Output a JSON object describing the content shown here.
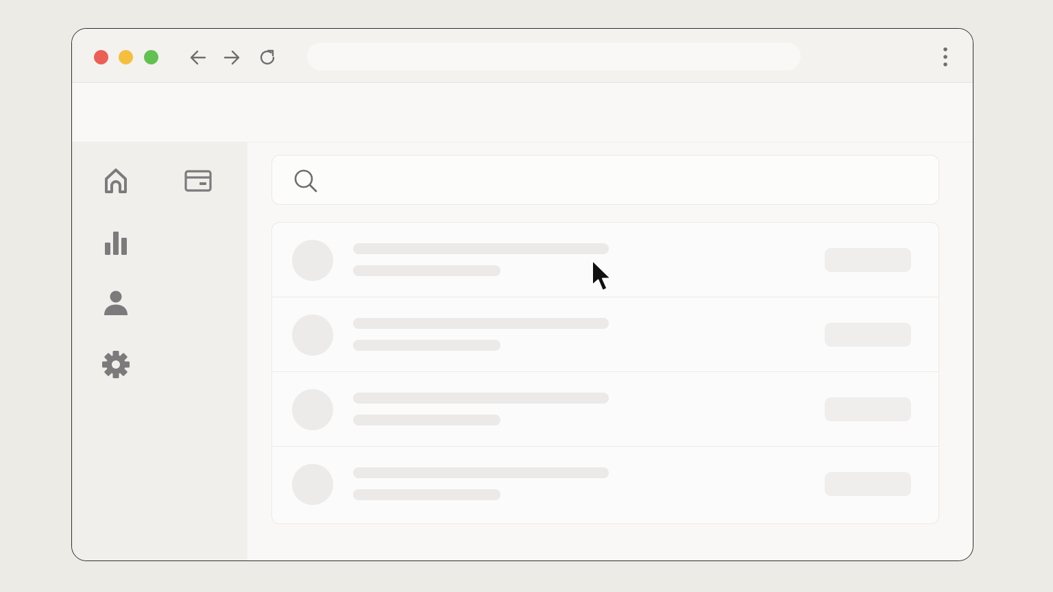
{
  "browser": {
    "traffic_lights": {
      "close": "#ec5f55",
      "minimize": "#f5bf3e",
      "maximize": "#62c150"
    },
    "icons": {
      "back": "arrow-left-icon",
      "forward": "arrow-right-icon",
      "reload": "reload-icon",
      "menu": "kebab-menu-icon"
    },
    "address_bar": {
      "value": "",
      "placeholder": ""
    }
  },
  "sidebar": {
    "items": [
      {
        "icon": "home-icon"
      },
      {
        "icon": "card-icon"
      },
      {
        "icon": "bar-chart-icon"
      },
      {
        "icon": "user-icon"
      },
      {
        "icon": "gear-icon"
      }
    ]
  },
  "search": {
    "icon": "search-icon",
    "value": "",
    "placeholder": ""
  },
  "list": {
    "state": "loading-skeleton",
    "rows": [
      {},
      {},
      {},
      {}
    ]
  },
  "colors": {
    "page_background": "#edebe6",
    "window_background": "#f9f8f6",
    "sidebar_background": "#f0efec",
    "icon_color": "#7b7b7b",
    "skeleton": "#ebeae8"
  }
}
